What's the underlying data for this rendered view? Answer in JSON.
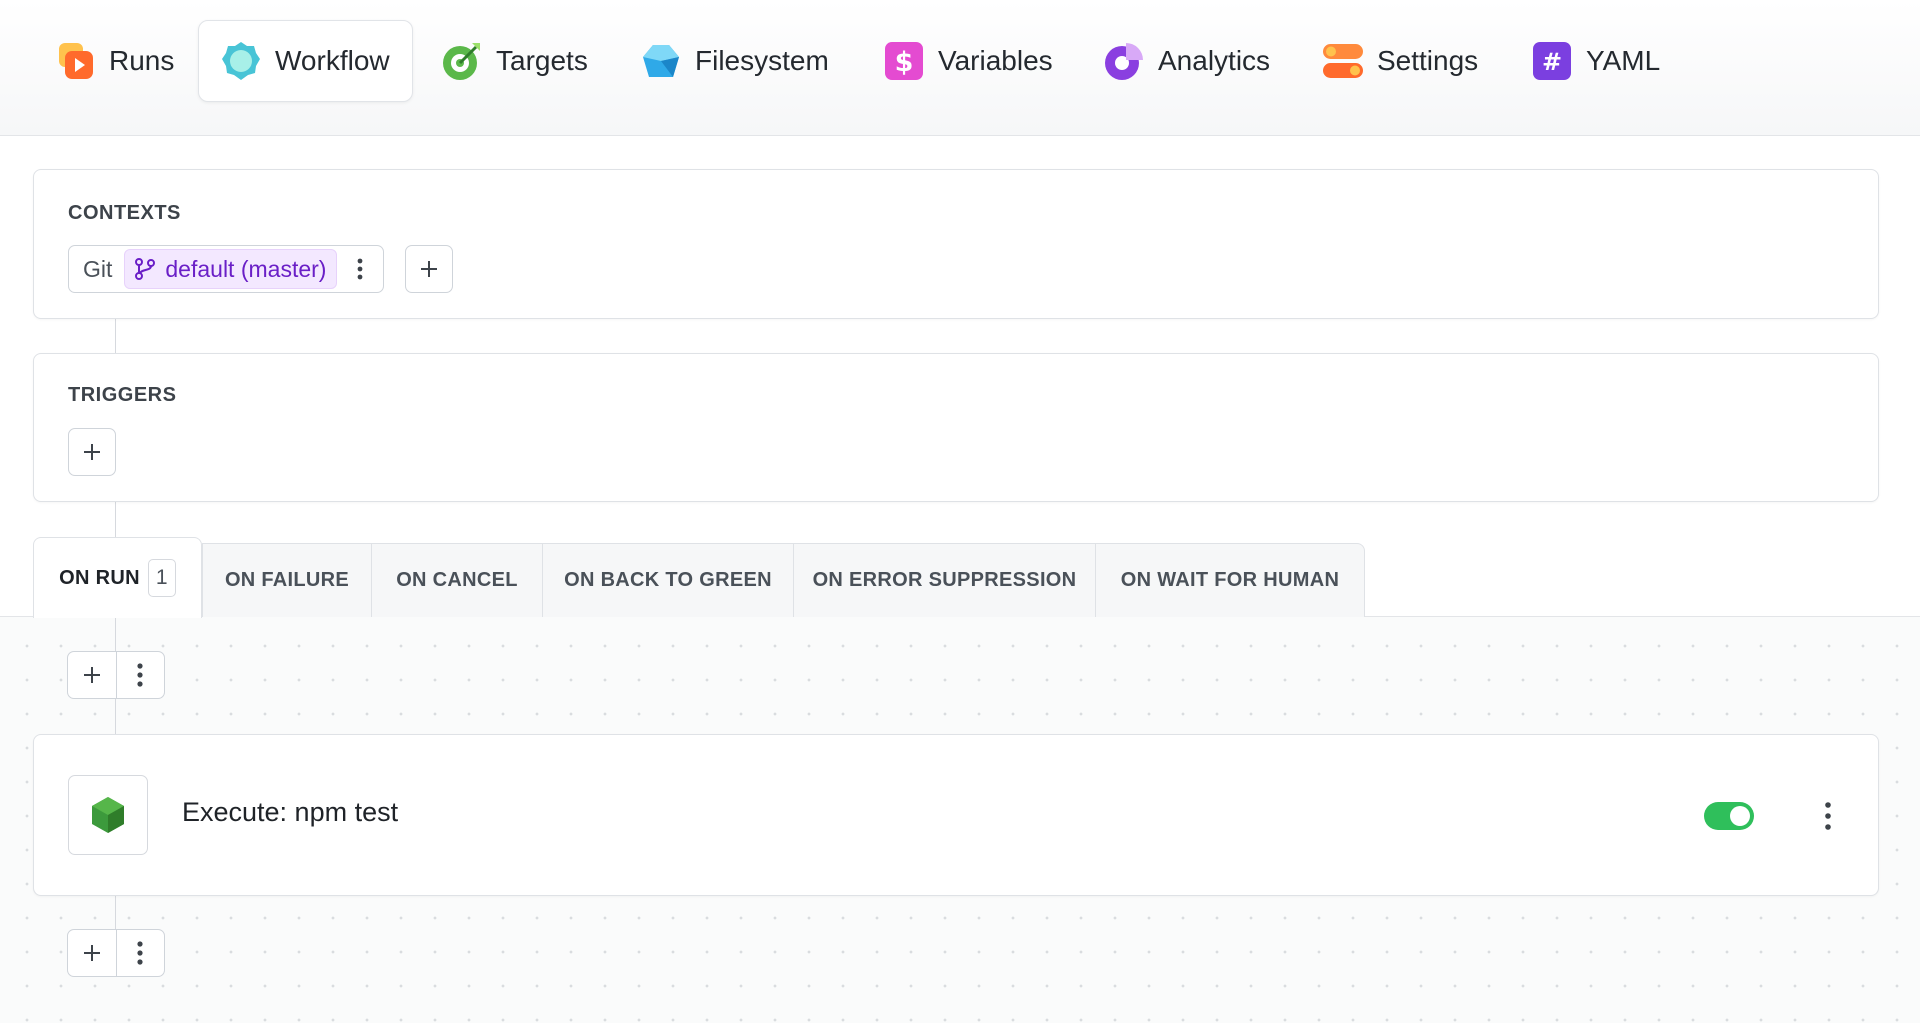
{
  "nav": {
    "tabs": [
      {
        "label": "Runs",
        "icon": "runs-icon"
      },
      {
        "label": "Workflow",
        "icon": "workflow-icon",
        "active": true
      },
      {
        "label": "Targets",
        "icon": "targets-icon"
      },
      {
        "label": "Filesystem",
        "icon": "filesystem-icon"
      },
      {
        "label": "Variables",
        "icon": "variables-icon"
      },
      {
        "label": "Analytics",
        "icon": "analytics-icon"
      },
      {
        "label": "Settings",
        "icon": "settings-icon"
      },
      {
        "label": "YAML",
        "icon": "yaml-icon"
      }
    ]
  },
  "contexts": {
    "title": "CONTEXTS",
    "items": [
      {
        "type_label": "Git",
        "branch_label": "default (master)",
        "icon": "git-branch-icon"
      }
    ]
  },
  "triggers": {
    "title": "TRIGGERS"
  },
  "event_tabs": [
    {
      "label": "ON RUN",
      "count": "1",
      "active": true
    },
    {
      "label": "ON FAILURE"
    },
    {
      "label": "ON CANCEL"
    },
    {
      "label": "ON BACK TO GREEN"
    },
    {
      "label": "ON ERROR SUPPRESSION"
    },
    {
      "label": "ON WAIT FOR HUMAN"
    }
  ],
  "steps": [
    {
      "title": "Execute: npm test",
      "icon": "nodejs-hexagon-icon",
      "enabled": true
    }
  ],
  "colors": {
    "accent_purple": "#6a1fc7",
    "toggle_on": "#2fbf5b",
    "node_green": "#3c9a3c"
  }
}
